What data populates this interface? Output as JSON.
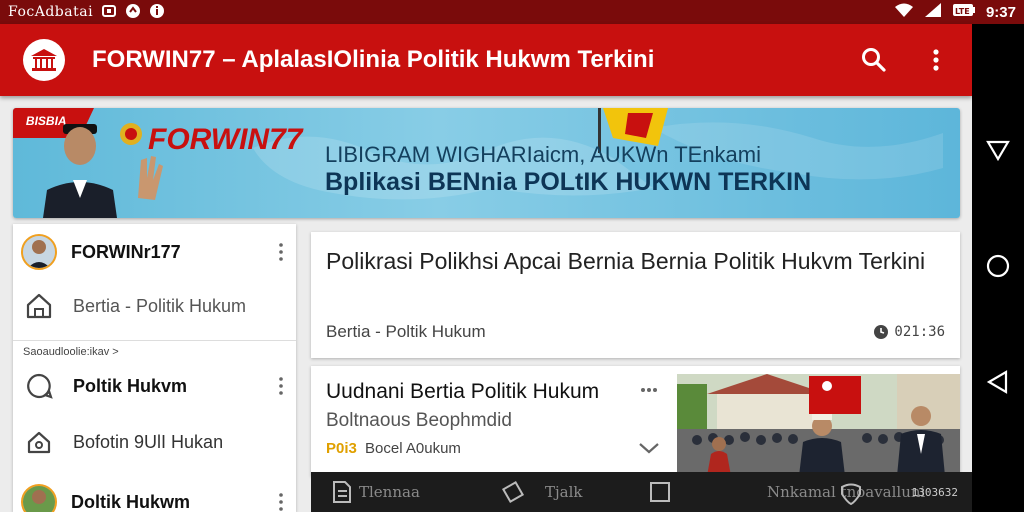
{
  "status_bar": {
    "app_name": "FocAdbatai",
    "time": "9:37",
    "battery_label": "LTE"
  },
  "app_bar": {
    "title": "FORWIN77 – AplalasIOlinia Politik Hukwm Terkini"
  },
  "banner": {
    "ribbon_text": "BISBIA",
    "brand": "FORWIN77",
    "line1": "LIBIGRAM WIGHARIaicm, AUKWn TEnkami",
    "line2": "Bplikasi BENnia POLtIK HUKWN TERKIN"
  },
  "left_panel": {
    "account_name": "FORWINr177",
    "home_item": "Bertia - Politik Hukum",
    "section_label": "Saoaudloolie:ikav >",
    "items": [
      {
        "label": "Poltik Hukvm"
      },
      {
        "label": "Bofotin 9UlI Hukan"
      },
      {
        "label": "Doltik Hukwm"
      }
    ]
  },
  "articles": [
    {
      "title": "Polikrasi Polikhsi Apcai Bernia Bernia Politik Hukvm Terkini",
      "category": "Bertia - Poltik Hukum",
      "meta": "021:36"
    },
    {
      "title": "Uudnani Bertia Politik Hukum",
      "subtitle": "Boltnaous Beophmdid",
      "tag": "P0i3",
      "category": "Bocel A0ukum"
    }
  ],
  "bottom_nav": {
    "items": [
      {
        "label": "Tlennaa"
      },
      {
        "label": "Tjalk"
      },
      {
        "label": ""
      },
      {
        "label": "Nnkamal tnoavalluni"
      }
    ],
    "count": "1303632"
  },
  "colors": {
    "primary": "#c8100f",
    "status_bar": "#7a0b0b",
    "nav_bar": "#000000",
    "background": "#ececec"
  }
}
